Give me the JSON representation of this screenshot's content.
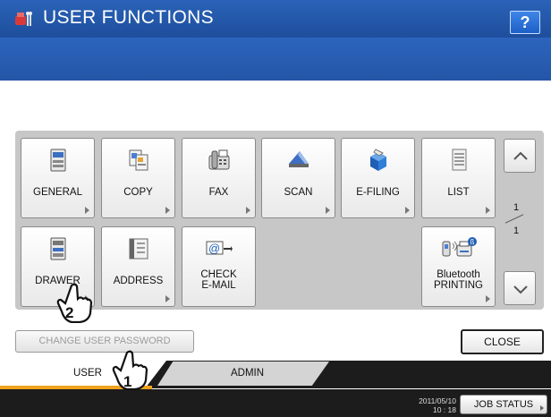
{
  "header": {
    "title": "USER FUNCTIONS",
    "help_label": "?"
  },
  "functions": [
    {
      "label": "GENERAL",
      "icon": "printer-icon"
    },
    {
      "label": "COPY",
      "icon": "copy-icon"
    },
    {
      "label": "FAX",
      "icon": "fax-icon"
    },
    {
      "label": "SCAN",
      "icon": "scanner-icon"
    },
    {
      "label": "E-FILING",
      "icon": "e-filing-box-icon"
    },
    {
      "label": "LIST",
      "icon": "list-icon"
    },
    {
      "label": "DRAWER",
      "icon": "drawer-printer-icon"
    },
    {
      "label": "ADDRESS",
      "icon": "address-book-icon"
    },
    {
      "label_line1": "CHECK",
      "label_line2": "E-MAIL",
      "icon": "email-icon"
    },
    {
      "label_line1": "Bluetooth",
      "label_line2": "PRINTING",
      "icon": "bluetooth-printer-icon"
    }
  ],
  "pager": {
    "current": "1",
    "total": "1"
  },
  "buttons": {
    "change_password": "CHANGE USER PASSWORD",
    "close": "CLOSE"
  },
  "tabs": {
    "user": "USER",
    "admin": "ADMIN"
  },
  "status": {
    "date": "2011/05/10",
    "time": "10 : 18",
    "job_status": "JOB STATUS"
  },
  "callouts": {
    "first": "1",
    "second": "2"
  },
  "colors": {
    "title_blue": "#1e4e9c",
    "accent_orange": "#f0a21e"
  }
}
